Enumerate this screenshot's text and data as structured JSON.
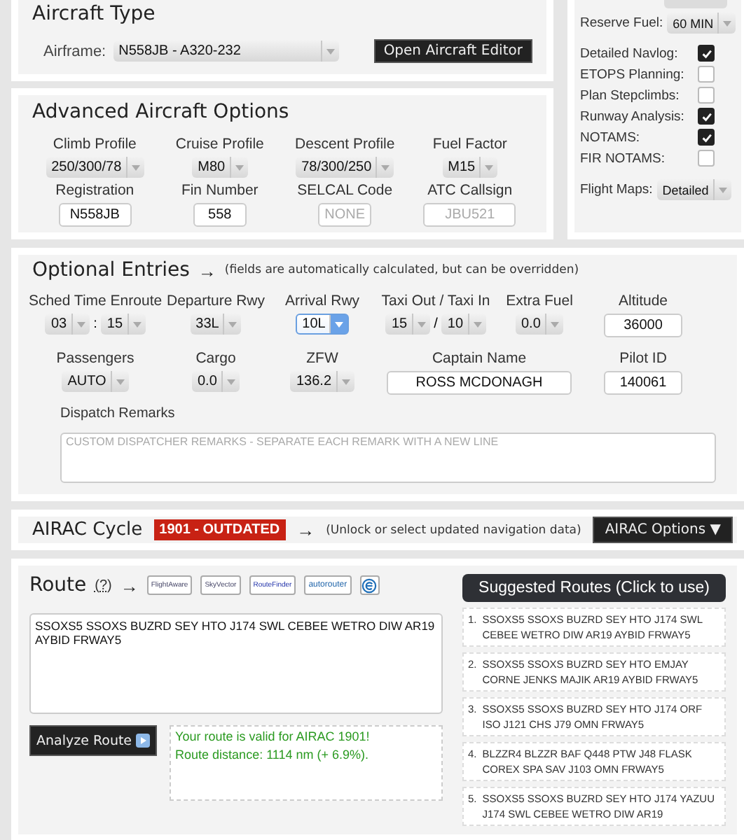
{
  "aircraft_type": {
    "title": "Aircraft Type",
    "airframe_label": "Airframe:",
    "airframe": "N558JB - A320-232",
    "editor_button": "Open Aircraft Editor"
  },
  "advanced": {
    "title": "Advanced Aircraft Options",
    "fields": [
      {
        "label": "Climb Profile",
        "kind": "select",
        "value": "250/300/78"
      },
      {
        "label": "Cruise Profile",
        "kind": "select",
        "value": "M80"
      },
      {
        "label": "Descent Profile",
        "kind": "select",
        "value": "78/300/250"
      },
      {
        "label": "Fuel Factor",
        "kind": "select",
        "value": "M15"
      },
      {
        "label": "Registration",
        "kind": "input",
        "value": "N558JB"
      },
      {
        "label": "Fin Number",
        "kind": "input",
        "value": "558"
      },
      {
        "label": "SELCAL Code",
        "kind": "input",
        "placeholder": "NONE"
      },
      {
        "label": "ATC Callsign",
        "kind": "input",
        "placeholder": "JBU521"
      }
    ]
  },
  "options": {
    "reserve_fuel_label": "Reserve Fuel:",
    "reserve_fuel": "60 MIN",
    "checks": [
      {
        "label": "Detailed Navlog:",
        "checked": true
      },
      {
        "label": "ETOPS Planning:",
        "checked": false
      },
      {
        "label": "Plan Stepclimbs:",
        "checked": false
      },
      {
        "label": "Runway Analysis:",
        "checked": true
      },
      {
        "label": "NOTAMS:",
        "checked": true
      },
      {
        "label": "FIR NOTAMS:",
        "checked": false
      }
    ],
    "flight_maps_label": "Flight Maps:",
    "flight_maps": "Detailed"
  },
  "optional_entries": {
    "title": "Optional Entries",
    "arrow": "→",
    "note": "(fields are automatically calculated, but can be overridden)",
    "fields": [
      {
        "label": "Sched Time Enroute",
        "kind": "pair",
        "values": [
          "03",
          "15"
        ],
        "separator": ":",
        "focused": false
      },
      {
        "label": "Departure Rwy",
        "kind": "select",
        "value": "33L",
        "focused": false
      },
      {
        "label": "Arrival Rwy",
        "kind": "select",
        "value": "10L",
        "focused": true
      },
      {
        "label": "Taxi Out / Taxi In",
        "kind": "pair",
        "values": [
          "15",
          "10"
        ],
        "separator": "/",
        "focused": false
      },
      {
        "label": "Extra Fuel",
        "kind": "select",
        "value": "0.0",
        "focused": false
      },
      {
        "label": "Altitude",
        "kind": "input",
        "value": "36000",
        "focused": false
      },
      {
        "label": "Passengers",
        "kind": "select",
        "value": "AUTO",
        "focused": false
      },
      {
        "label": "Cargo",
        "kind": "select",
        "value": "0.0",
        "focused": false
      },
      {
        "label": "ZFW",
        "kind": "select",
        "value": "136.2",
        "focused": false
      },
      {
        "label": "Captain Name",
        "kind": "wide",
        "value": "ROSS MCDONAGH",
        "focused": false
      },
      {
        "label": "Pilot ID",
        "kind": "input",
        "value": "140061",
        "focused": false
      }
    ],
    "remarks_label": "Dispatch Remarks",
    "remarks_placeholder": "CUSTOM DISPATCHER REMARKS - SEPARATE EACH REMARK WITH A NEW LINE"
  },
  "airac": {
    "title": "AIRAC Cycle",
    "badge": "1901 - OUTDATED",
    "arrow": "→",
    "note": "(Unlock or select updated navigation data)",
    "button": "AIRAC Options ▼"
  },
  "route": {
    "title": "Route",
    "help": "(?)",
    "arrow": "→",
    "services": [
      "FlightAware",
      "SkyVector",
      "RouteFinder",
      "autorouter"
    ],
    "value": "SSOXS5 SSOXS BUZRD SEY HTO J174 SWL CEBEE WETRO DIW AR19 AYBID FRWAY5",
    "analyze_button": "Analyze Route",
    "validation": [
      "Your route is valid for AIRAC 1901!",
      "Route distance: 1114 nm (+ 6.9%)."
    ],
    "suggested_title": "Suggested Routes (Click to use)",
    "suggested": [
      {
        "number": "1.",
        "text": "SSOXS5 SSOXS BUZRD SEY HTO J174 SWL CEBEE WETRO DIW AR19 AYBID FRWAY5"
      },
      {
        "number": "2.",
        "text": "SSOXS5 SSOXS BUZRD SEY HTO EMJAY CORNE JENKS MAJIK AR19 AYBID FRWAY5"
      },
      {
        "number": "3.",
        "text": "SSOXS5 SSOXS BUZRD SEY HTO J174 ORF ISO J121 CHS J79 OMN FRWAY5"
      },
      {
        "number": "4.",
        "text": "BLZZR4 BLZZR BAF Q448 PTW J48 FLASK COREX SPA SAV J103 OMN FRWAY5"
      },
      {
        "number": "5.",
        "text": "SSOXS5 SSOXS BUZRD SEY HTO J174 YAZUU J174 SWL CEBEE WETRO DIW AR19"
      }
    ]
  }
}
